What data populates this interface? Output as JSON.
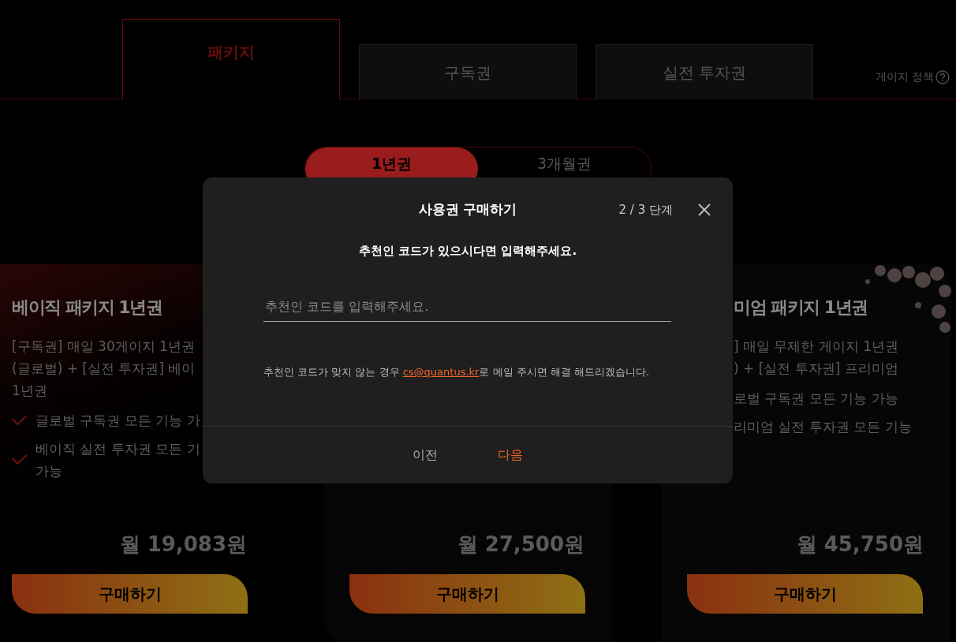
{
  "tabs": [
    {
      "label": "패키지",
      "selected": true
    },
    {
      "label": "구독권",
      "selected": false
    },
    {
      "label": "실전 투자권",
      "selected": false
    }
  ],
  "gauge_policy": {
    "label": "게이지 정책"
  },
  "period_toggle": [
    {
      "label": "1년권",
      "selected": true
    },
    {
      "label": "3개월권",
      "selected": false
    }
  ],
  "cards": [
    {
      "title": "베이직 패키지 1년권",
      "description": [
        "[구독권] 매일 30게이지 1년권",
        "(글로벌) + [실전 투자권] 베이",
        "1년권"
      ],
      "features": [
        {
          "kind": "check",
          "lines": [
            "글로벌 구독권 모든 기능 가"
          ]
        },
        {
          "kind": "check",
          "lines": [
            "베이직 실전 투자권 모든 기",
            "가능"
          ]
        }
      ],
      "price": "월 19,083원",
      "button": "구매하기"
    },
    {
      "price": "월 27,500원",
      "button": "구매하기"
    },
    {
      "title": "미엄 패키지 1년권",
      "description": [
        "] 매일 무제한 게이지 1년권",
        ") + [실전 투자권] 프리미엄"
      ],
      "features": [
        {
          "kind": "plain",
          "lines": [
            "로벌 구독권 모든 기능 가능"
          ]
        },
        {
          "kind": "plain",
          "lines": [
            "리미엄 실전 투자권 모든 기능"
          ]
        }
      ],
      "price": "월 45,750원",
      "button": "구매하기"
    }
  ],
  "modal": {
    "title": "사용권 구매하기",
    "step": "2 / 3 단계",
    "subtitle": "추천인 코드가 있으시다면 입력해주세요.",
    "input": {
      "placeholder": "추천인 코드를 입력해주세요."
    },
    "note": {
      "before": "추천인 코드가 맞지 않는 경우 ",
      "link": "cs@quantus.kr",
      "after": "로 메일 주시면 해결 해드리겠습니다."
    },
    "buttons": [
      {
        "label": "이전",
        "kind": "secondary"
      },
      {
        "label": "다음",
        "kind": "primary"
      }
    ]
  }
}
